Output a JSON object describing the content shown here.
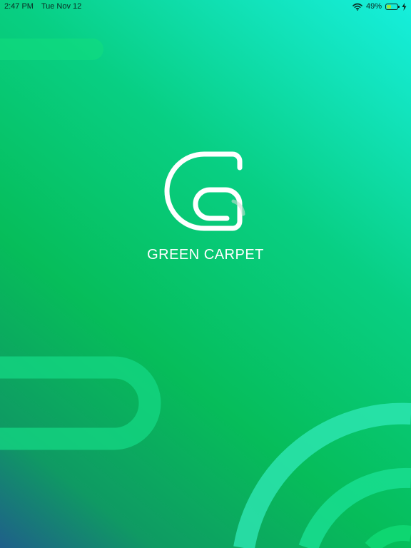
{
  "status_bar": {
    "time": "2:47 PM",
    "date": "Tue Nov 12",
    "battery_text": "49%",
    "battery_level": 0.49,
    "icons": [
      "wifi-icon",
      "battery-icon",
      "charging-bolt-icon"
    ]
  },
  "splash": {
    "logo": "green-carpet-g-logo",
    "brand_name": "GREEN CARPET"
  },
  "colors": {
    "text_on_brand": "#ffffff",
    "status_text": "#0b2a22",
    "battery_fill": "#9be83b",
    "gradient_start": "#1f5f8a",
    "gradient_mid": "#06bd5a",
    "gradient_end": "#16efde"
  }
}
